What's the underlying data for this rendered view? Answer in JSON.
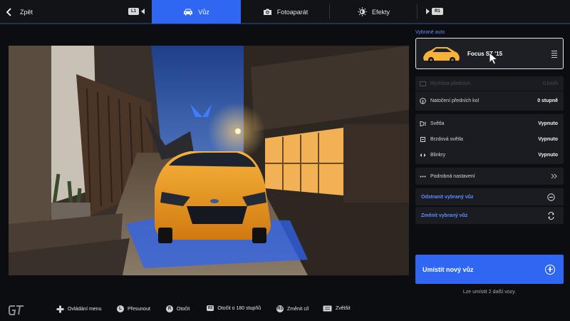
{
  "topbar": {
    "back_label": "Zpět",
    "l1_label": "L1",
    "r1_label": "R1",
    "tabs": [
      {
        "label": "Vůz",
        "icon": "car-icon"
      },
      {
        "label": "Fotoaparát",
        "icon": "camera-icon"
      },
      {
        "label": "Efekty",
        "icon": "brightness-icon"
      }
    ]
  },
  "panel": {
    "section_label": "Vybrané auto",
    "selected_car": "Focus ST '15",
    "rows": {
      "speed": {
        "label": "Rychlost předních",
        "value": "0 km/h"
      },
      "steer": {
        "label": "Natočení předních kol",
        "value": "0 stupně"
      },
      "lights": {
        "label": "Světla",
        "value": "Vypnuto"
      },
      "brake": {
        "label": "Brzdová světla",
        "value": "Vypnuto"
      },
      "blink": {
        "label": "Blinkry",
        "value": "Vypnuto"
      },
      "detail": {
        "label": "Podrobná nastavení"
      },
      "remove": {
        "label": "Odstranit vybraný vůz"
      },
      "change": {
        "label": "Změnit vybraný vůz"
      }
    },
    "place_button": "Umístit nový vůz",
    "note": "Lze umístit 2 další vozy."
  },
  "bottombar": {
    "hints": [
      {
        "label": "Ovládání menu",
        "button": ""
      },
      {
        "label": "Přesunout",
        "button": "L"
      },
      {
        "label": "Otočit",
        "button": "R"
      },
      {
        "label": "Otočit o 180 stupňů",
        "button": "R2"
      },
      {
        "label": "Změnit cíl",
        "button": "R3"
      },
      {
        "label": "Zvětšit",
        "button": ""
      }
    ]
  },
  "colors": {
    "accent": "#2f66f2",
    "accent_text": "#5f8cff",
    "car": "#f39a1c",
    "background": "#0c0d10"
  }
}
